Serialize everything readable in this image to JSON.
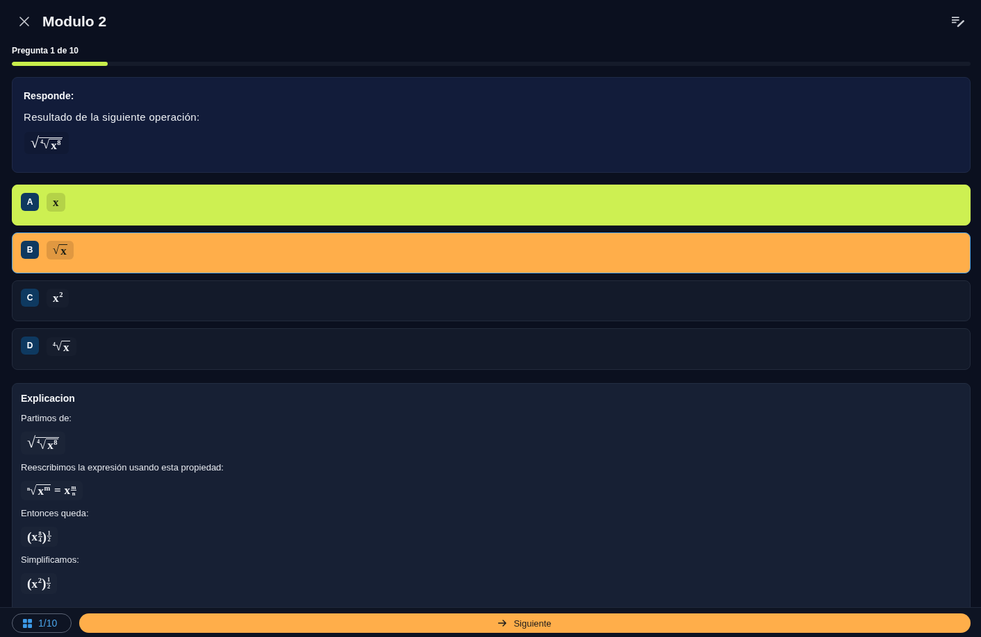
{
  "header": {
    "title": "Modulo 2"
  },
  "progress": {
    "label": "Pregunta 1 de 10",
    "level": 0.1
  },
  "question": {
    "heading": "Responde:",
    "prompt": "Resultado de la siguiente operación:",
    "formula": {
      "kind": "root",
      "sign": "√",
      "body": {
        "kind": "root",
        "sign": "√",
        "index": "4",
        "body": {
          "kind": "pow",
          "base": "x",
          "exp": "8"
        }
      }
    }
  },
  "options": [
    {
      "letter": "A",
      "selected": false,
      "correct": true,
      "formula": "x"
    },
    {
      "letter": "B",
      "selected": true,
      "correct": false,
      "formula": {
        "kind": "root",
        "sign": "√",
        "body": "x"
      }
    },
    {
      "letter": "C",
      "selected": false,
      "correct": false,
      "formula": {
        "kind": "pow",
        "base": "x",
        "exp": "2"
      }
    },
    {
      "letter": "D",
      "selected": false,
      "correct": false,
      "formula": {
        "kind": "root",
        "sign": "√",
        "index": "4",
        "body": "x"
      }
    }
  ],
  "explanation": {
    "title": "Explicacion",
    "blocks": [
      {
        "kind": "text",
        "text": "Partimos de:"
      },
      {
        "kind": "math",
        "formula": {
          "kind": "root",
          "sign": "√",
          "body": {
            "kind": "root",
            "sign": "√",
            "index": "4",
            "body": {
              "kind": "pow",
              "base": "x",
              "exp": "8"
            }
          }
        }
      },
      {
        "kind": "text",
        "text": "Reescribimos la expresión usando esta propiedad:"
      },
      {
        "kind": "math",
        "formula": {
          "kind": "row",
          "items": [
            {
              "kind": "root",
              "sign": "√",
              "index": "n",
              "body": {
                "kind": "pow",
                "base": "x",
                "exp": "m"
              }
            },
            "=",
            {
              "kind": "pow",
              "base": "x",
              "exp": {
                "kind": "frac",
                "num": "m",
                "den": "n"
              }
            }
          ]
        }
      },
      {
        "kind": "text",
        "text": "Entonces queda:"
      },
      {
        "kind": "math",
        "formula": {
          "kind": "pow",
          "base": {
            "kind": "paren",
            "open": "(",
            "close": ")",
            "body": {
              "kind": "pow",
              "base": "x",
              "exp": {
                "kind": "frac",
                "num": "8",
                "den": "4"
              }
            }
          },
          "exp": {
            "kind": "frac",
            "num": "1",
            "den": "2"
          }
        }
      },
      {
        "kind": "text",
        "text": "Simplificamos:"
      },
      {
        "kind": "math",
        "formula": {
          "kind": "pow",
          "base": {
            "kind": "paren",
            "open": "(",
            "close": ")",
            "body": {
              "kind": "pow",
              "base": "x",
              "exp": "2"
            }
          },
          "exp": {
            "kind": "frac",
            "num": "1",
            "den": "2"
          }
        }
      }
    ]
  },
  "footer": {
    "counter": "1/10",
    "next_label": "Siguiente"
  }
}
